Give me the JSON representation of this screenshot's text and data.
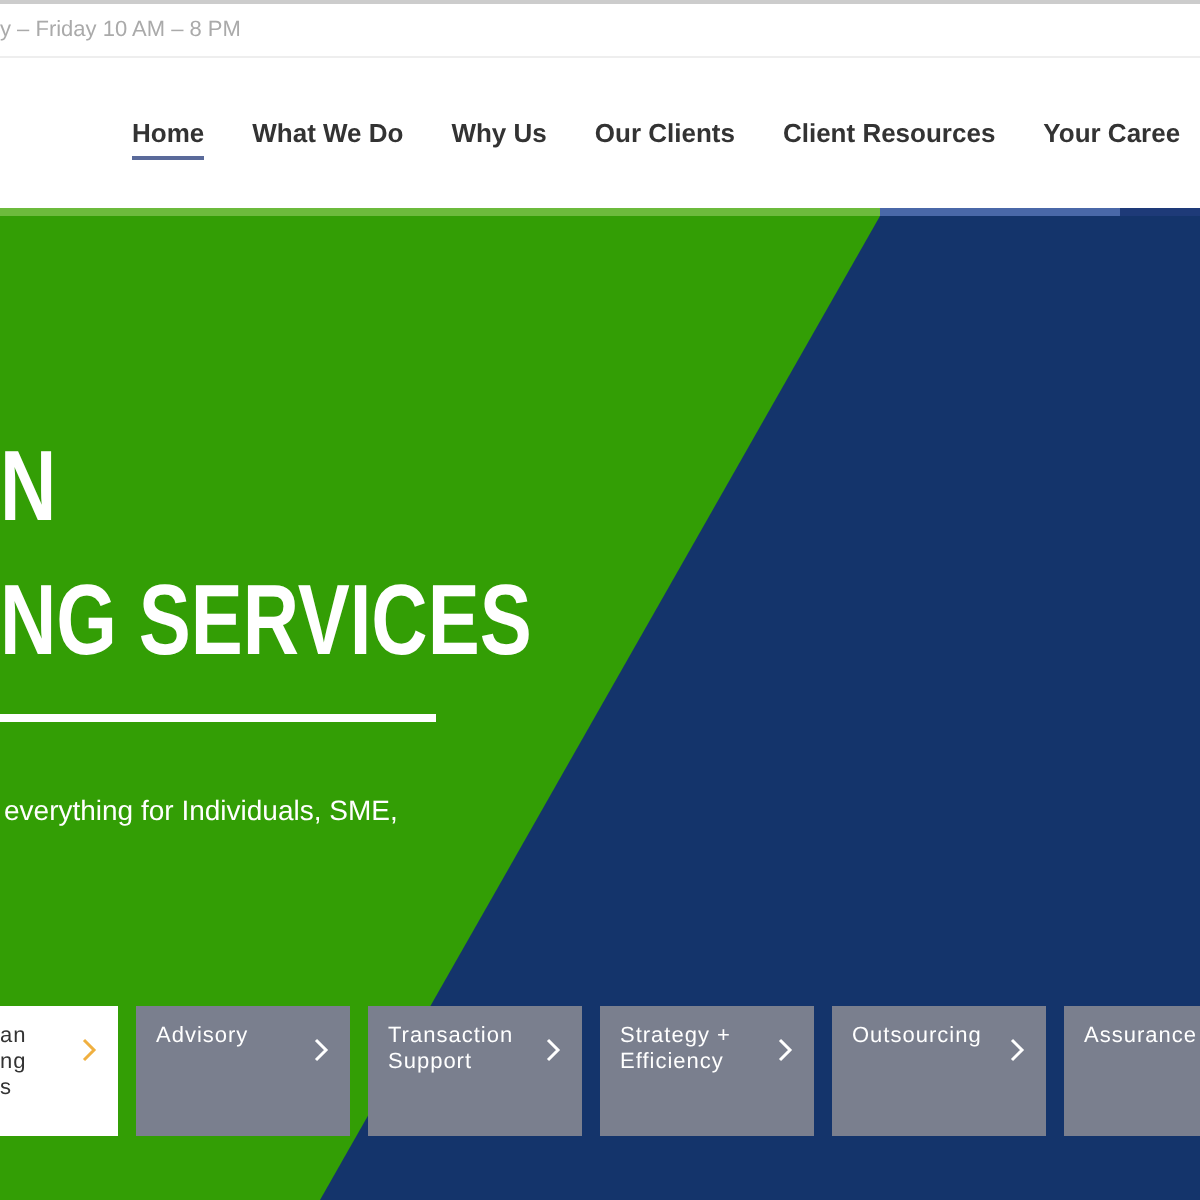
{
  "top_bar": {
    "hours": "y – Friday 10 AM – 8 PM"
  },
  "nav": {
    "items": [
      {
        "label": "Home",
        "selected": true
      },
      {
        "label": "What We Do",
        "selected": false
      },
      {
        "label": "Why Us",
        "selected": false
      },
      {
        "label": "Our Clients",
        "selected": false
      },
      {
        "label": "Client Resources",
        "selected": false
      },
      {
        "label": "Your Caree",
        "selected": false
      }
    ]
  },
  "hero": {
    "headline": [
      "N",
      "NG SERVICES"
    ],
    "subtitle": "everything for Individuals, SME,",
    "cards": [
      {
        "lines": [
          "an",
          "ng",
          "s"
        ],
        "selected": true
      },
      {
        "lines": [
          "Advisory"
        ],
        "selected": false
      },
      {
        "lines": [
          "Transaction",
          "Support"
        ],
        "selected": false
      },
      {
        "lines": [
          "Strategy +",
          "Efficiency"
        ],
        "selected": false
      },
      {
        "lines": [
          "Outsourcing"
        ],
        "selected": false
      },
      {
        "lines": [
          "Assurance"
        ],
        "selected": false
      }
    ]
  }
}
